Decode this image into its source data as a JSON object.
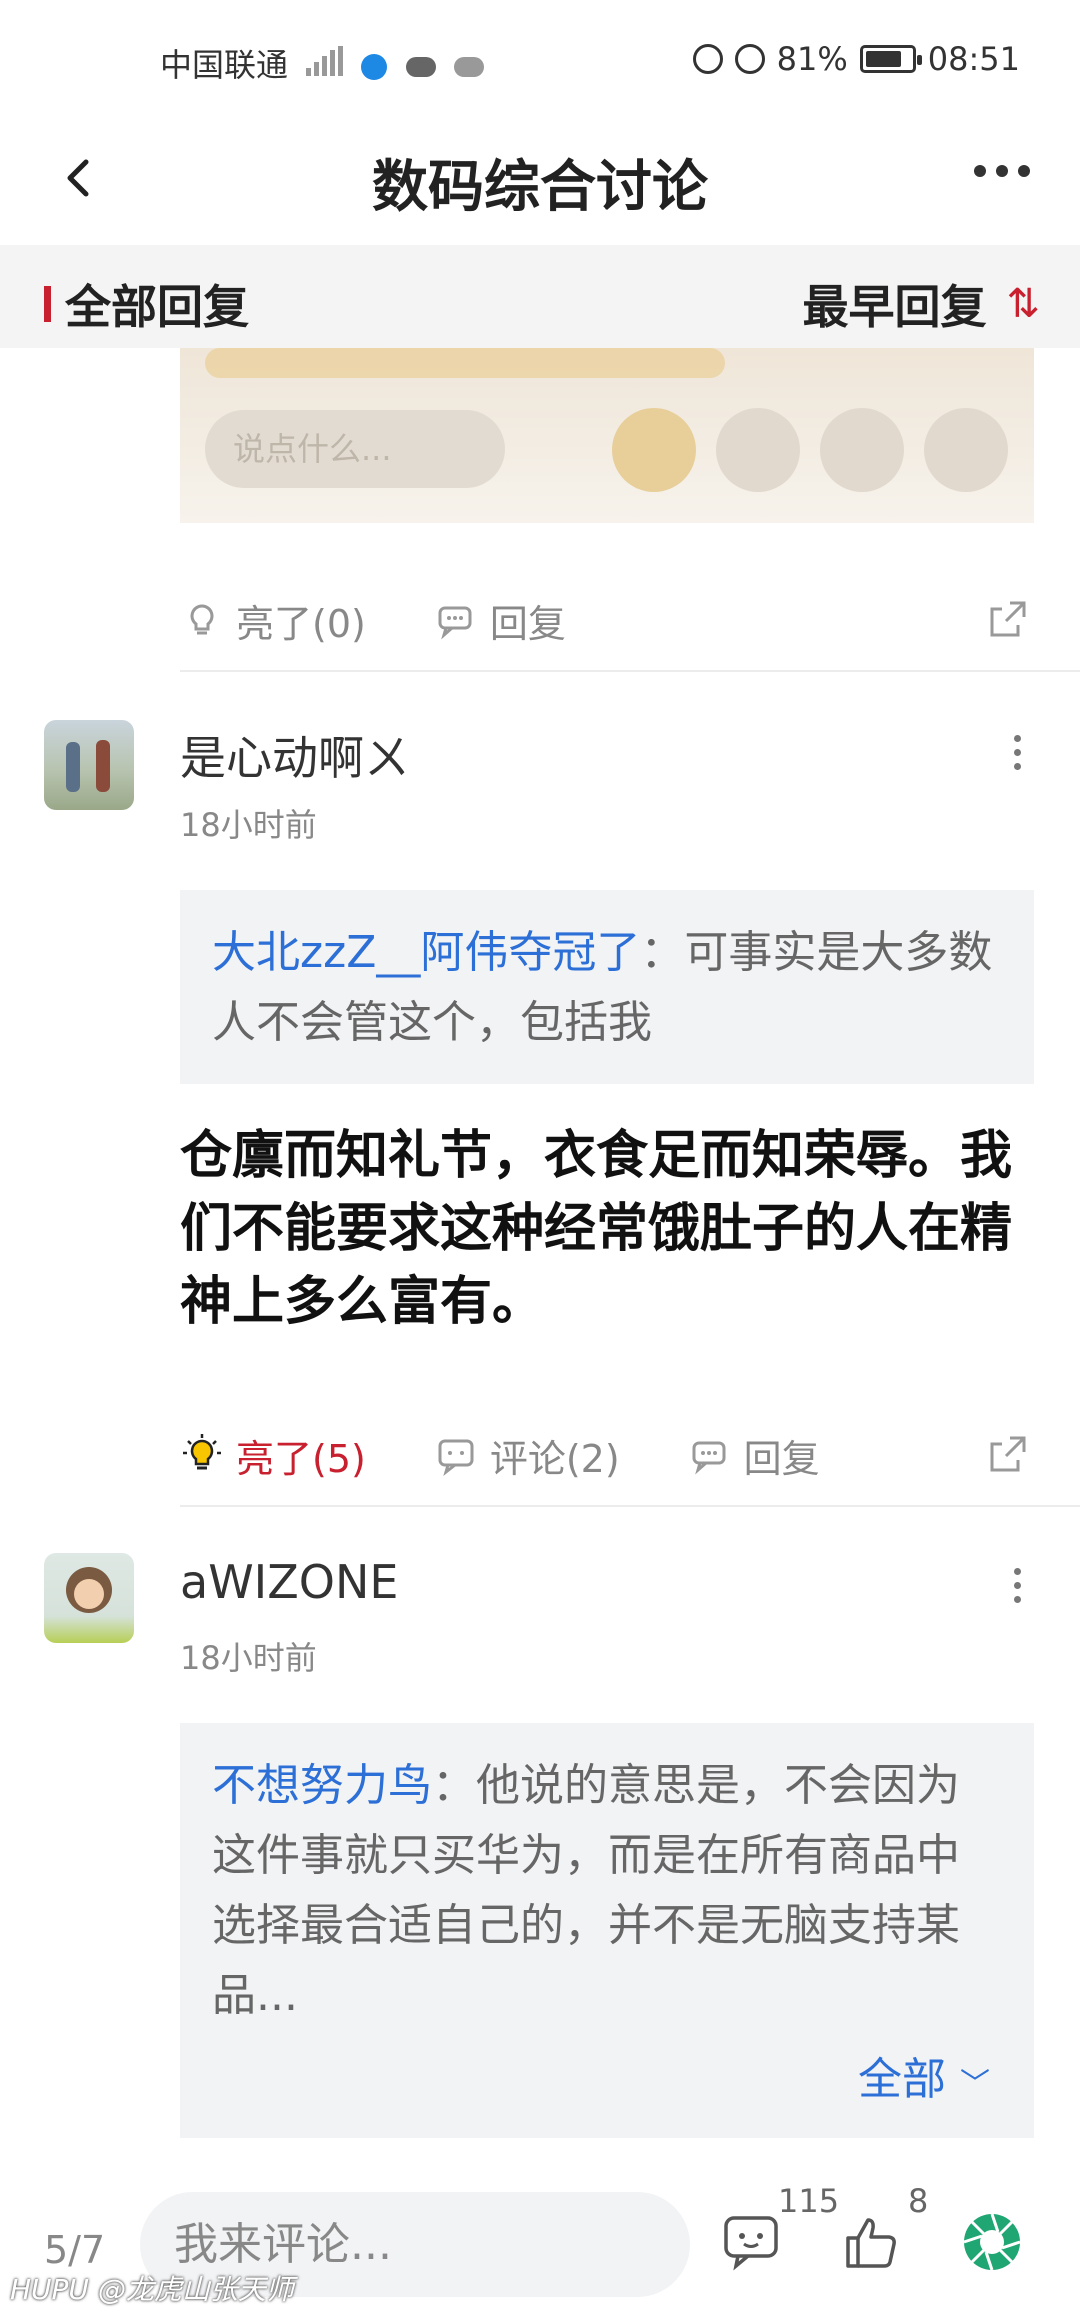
{
  "status_bar": {
    "carrier": "中国联通",
    "battery": "81%",
    "battery_level": 0.81,
    "time": "08:51"
  },
  "nav": {
    "title": "数码综合讨论"
  },
  "sort_bar": {
    "left_label": "全部回复",
    "right_label": "最早回复"
  },
  "image_fragment": {
    "input_placeholder": "说点什么..."
  },
  "first_actions": {
    "light_label": "亮了(0)",
    "reply_label": "回复"
  },
  "posts": [
    {
      "username": "是心动啊ㄨ",
      "time": "18小时前",
      "quote_user": "大北zzZ__阿伟夺冠了",
      "quote_text": "：可事实是大多数人不会管这个，包括我",
      "content": "仓廪而知礼节，衣食足而知荣辱。我们不能要求这种经常饿肚子的人在精神上多么富有。",
      "light_label": "亮了(5)",
      "comment_label": "评论(2)",
      "reply_label": "回复"
    },
    {
      "username": "aWIZONE",
      "time": "18小时前",
      "quote_user": "不想努力鸟",
      "quote_text": "：他说的意思是，不会因为这件事就只买华为，而是在所有商品中选择最合适自己的，并不是无脑支持某品...",
      "expand_label": "全部"
    }
  ],
  "bottom_bar": {
    "page_indicator": "5/7",
    "comment_placeholder": "我来评论...",
    "comment_count": "115",
    "like_count": "8"
  },
  "watermark": "HUPU @龙虎山张天师",
  "colors": {
    "accent_red": "#c8202f",
    "link_blue": "#2c6fd6"
  }
}
